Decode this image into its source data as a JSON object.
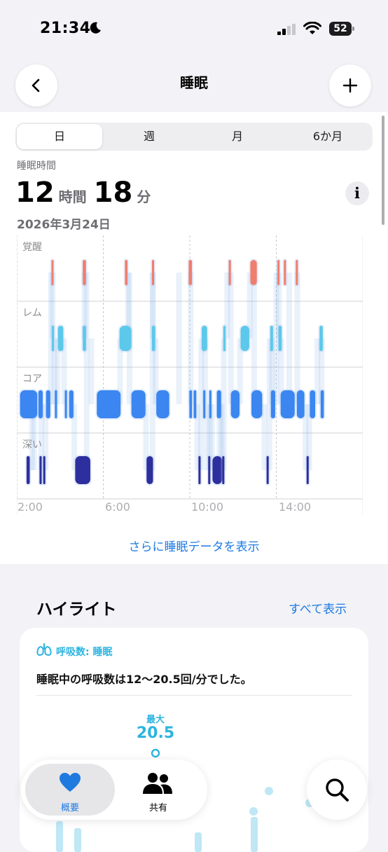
{
  "status_bar": {
    "time": "21:34",
    "battery": "52"
  },
  "nav": {
    "title": "睡眠"
  },
  "segments": [
    {
      "label": "日",
      "active": true
    },
    {
      "label": "週",
      "active": false
    },
    {
      "label": "月",
      "active": false
    },
    {
      "label": "6か月",
      "active": false
    }
  ],
  "summary": {
    "label": "睡眠時間",
    "hours": "12",
    "hours_unit": "時間",
    "minutes": "18",
    "minutes_unit": "分",
    "date": "2026年3月24日"
  },
  "chart_data": {
    "type": "timeline",
    "stages": [
      "覚醒",
      "レム",
      "コア",
      "深い"
    ],
    "x_ticks": [
      "2:00",
      "6:00",
      "10:00",
      "14:00"
    ],
    "x_range_hours": [
      2,
      18
    ],
    "stage_colors": {
      "覚醒": "#f07e6e",
      "レム": "#5cc8ea",
      "コア": "#3b86f0",
      "深い": "#2e2f9e"
    },
    "segments": [
      {
        "stage": "コア",
        "start": 2.15,
        "end": 2.95
      },
      {
        "stage": "深い",
        "start": 2.45,
        "end": 2.6
      },
      {
        "stage": "コア",
        "start": 3.0,
        "end": 3.2
      },
      {
        "stage": "深い",
        "start": 3.05,
        "end": 3.15
      },
      {
        "stage": "深い",
        "start": 3.22,
        "end": 3.32
      },
      {
        "stage": "コア",
        "start": 3.35,
        "end": 3.55
      },
      {
        "stage": "覚醒",
        "start": 3.6,
        "end": 3.7
      },
      {
        "stage": "レム",
        "start": 3.62,
        "end": 3.72
      },
      {
        "stage": "コア",
        "start": 3.76,
        "end": 3.86
      },
      {
        "stage": "レム",
        "start": 3.9,
        "end": 4.15
      },
      {
        "stage": "コア",
        "start": 4.22,
        "end": 4.32
      },
      {
        "stage": "コア",
        "start": 4.42,
        "end": 4.62
      },
      {
        "stage": "深い",
        "start": 4.7,
        "end": 5.4
      },
      {
        "stage": "覚醒",
        "start": 5.05,
        "end": 5.2
      },
      {
        "stage": "レム",
        "start": 5.05,
        "end": 5.2
      },
      {
        "stage": "コア",
        "start": 5.7,
        "end": 6.8
      },
      {
        "stage": "レム",
        "start": 6.75,
        "end": 7.3
      },
      {
        "stage": "覚醒",
        "start": 7.0,
        "end": 7.12
      },
      {
        "stage": "コア",
        "start": 7.3,
        "end": 7.95
      },
      {
        "stage": "深い",
        "start": 8.0,
        "end": 8.3
      },
      {
        "stage": "覚醒",
        "start": 8.25,
        "end": 8.35
      },
      {
        "stage": "レム",
        "start": 8.25,
        "end": 8.4
      },
      {
        "stage": "コア",
        "start": 8.45,
        "end": 9.05
      },
      {
        "stage": "覚醒",
        "start": 9.95,
        "end": 10.1
      },
      {
        "stage": "コア",
        "start": 9.98,
        "end": 10.1
      },
      {
        "stage": "コア",
        "start": 10.18,
        "end": 10.3
      },
      {
        "stage": "深い",
        "start": 10.4,
        "end": 10.5
      },
      {
        "stage": "レム",
        "start": 10.55,
        "end": 10.8
      },
      {
        "stage": "コア",
        "start": 10.62,
        "end": 10.72
      },
      {
        "stage": "深い",
        "start": 10.85,
        "end": 10.95
      },
      {
        "stage": "コア",
        "start": 10.9,
        "end": 11.0
      },
      {
        "stage": "深い",
        "start": 11.05,
        "end": 11.5
      },
      {
        "stage": "コア",
        "start": 11.25,
        "end": 11.45
      },
      {
        "stage": "深い",
        "start": 11.5,
        "end": 11.6
      },
      {
        "stage": "レム",
        "start": 11.55,
        "end": 11.65
      },
      {
        "stage": "覚醒",
        "start": 11.8,
        "end": 11.9
      },
      {
        "stage": "コア",
        "start": 11.9,
        "end": 12.3
      },
      {
        "stage": "レム",
        "start": 12.35,
        "end": 12.75
      },
      {
        "stage": "覚醒",
        "start": 12.8,
        "end": 13.1
      },
      {
        "stage": "コア",
        "start": 12.85,
        "end": 13.35
      },
      {
        "stage": "深い",
        "start": 13.55,
        "end": 13.65
      },
      {
        "stage": "レム",
        "start": 13.72,
        "end": 13.85
      },
      {
        "stage": "コア",
        "start": 13.75,
        "end": 13.95
      },
      {
        "stage": "覚醒",
        "start": 14.05,
        "end": 14.15
      },
      {
        "stage": "レム",
        "start": 14.1,
        "end": 14.25
      },
      {
        "stage": "覚醒",
        "start": 14.35,
        "end": 14.45
      },
      {
        "stage": "コア",
        "start": 14.2,
        "end": 14.85
      },
      {
        "stage": "覚醒",
        "start": 14.9,
        "end": 15.0
      },
      {
        "stage": "コア",
        "start": 14.95,
        "end": 15.3
      },
      {
        "stage": "深い",
        "start": 15.4,
        "end": 15.5
      },
      {
        "stage": "コア",
        "start": 15.55,
        "end": 15.8
      },
      {
        "stage": "レム",
        "start": 16.0,
        "end": 16.15
      },
      {
        "stage": "コア",
        "start": 16.05,
        "end": 16.2
      }
    ]
  },
  "more_link": "さらに睡眠データを表示",
  "highlights": {
    "title": "ハイライト",
    "see_all": "すべて表示",
    "card": {
      "category": "呼吸数: 睡眠",
      "text": "睡眠中の呼吸数は12〜20.5回/分でした。",
      "max_label": "最大",
      "max_value": "20.5"
    }
  },
  "tabbar": {
    "tabs": [
      {
        "label": "概要",
        "active": true
      },
      {
        "label": "共有",
        "active": false
      }
    ]
  },
  "colors": {
    "accent": "#1f7ae0",
    "respiratory": "#2db4e0"
  }
}
